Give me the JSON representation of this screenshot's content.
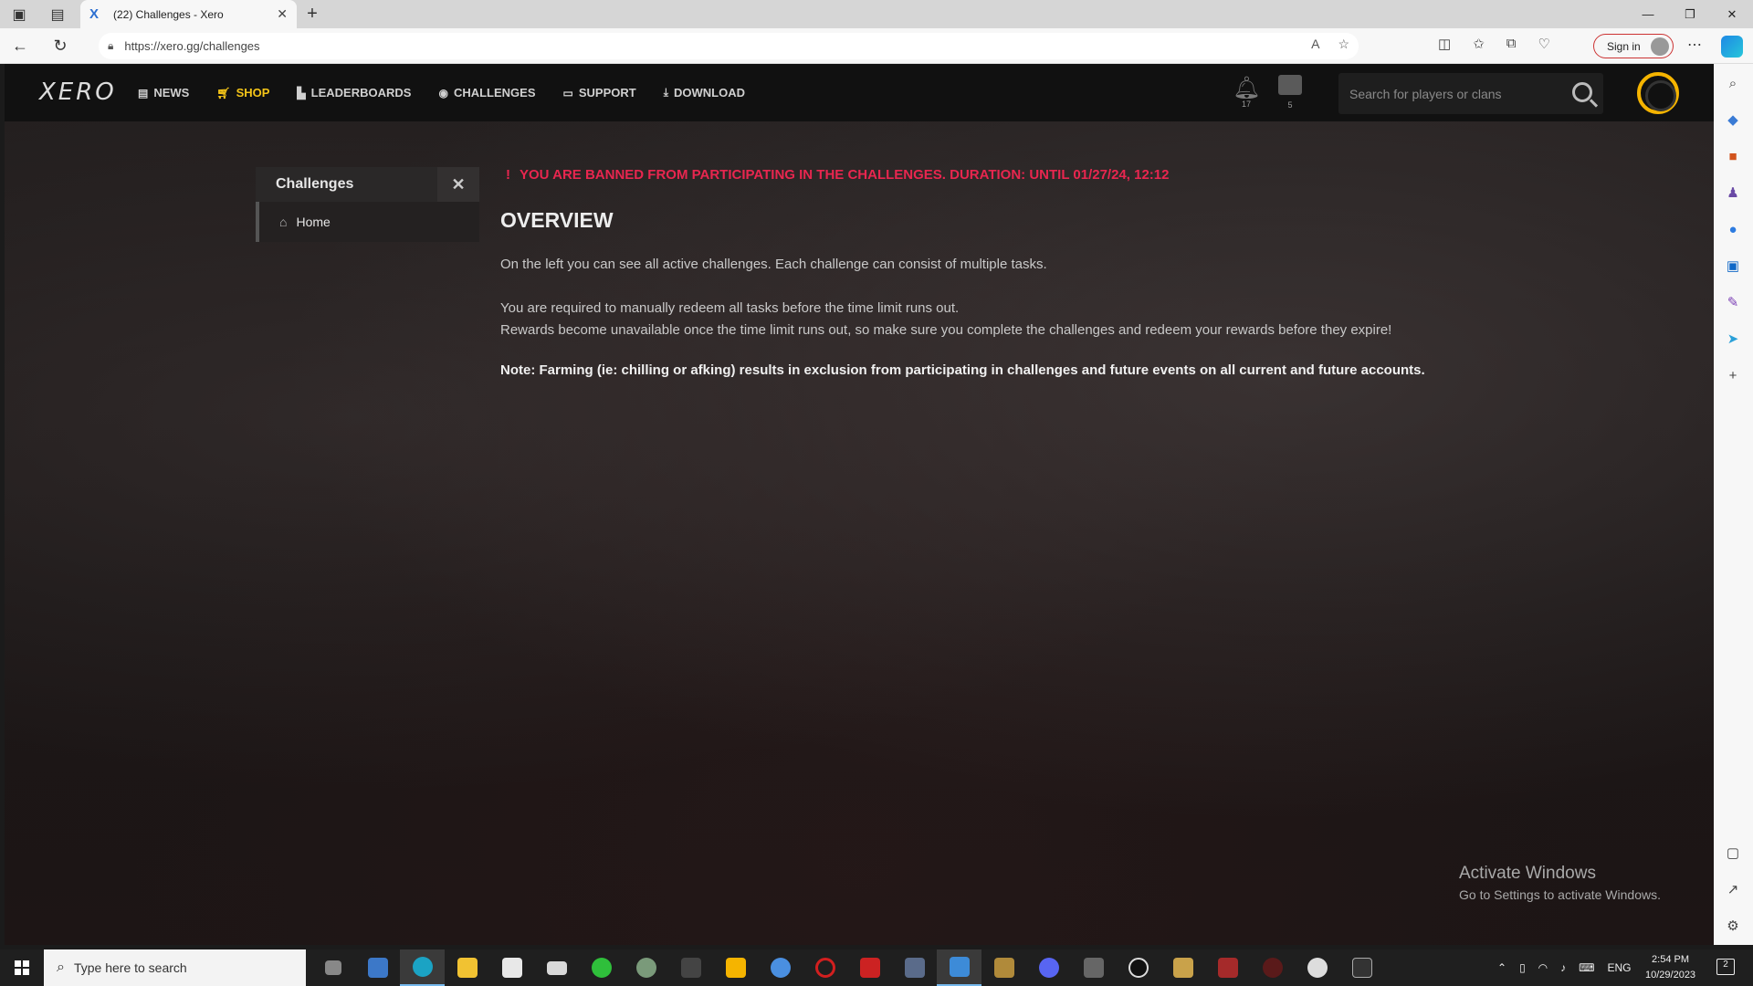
{
  "browser": {
    "tab_title": "(22) Challenges - Xero",
    "tab_favicon": "X",
    "url": "https://xero.gg/challenges",
    "signin_label": "Sign in"
  },
  "site": {
    "logo": "XERO",
    "nav": [
      {
        "label": "NEWS",
        "icon": "newspaper-icon"
      },
      {
        "label": "SHOP",
        "icon": "cart-icon",
        "color": "#f5c518"
      },
      {
        "label": "LEADERBOARDS",
        "icon": "leaderboard-icon"
      },
      {
        "label": "CHALLENGES",
        "icon": "medal-icon"
      },
      {
        "label": "SUPPORT",
        "icon": "ticket-icon"
      },
      {
        "label": "DOWNLOAD",
        "icon": "download-icon"
      }
    ],
    "notifications_count": "17",
    "messages_count": "5",
    "search_placeholder": "Search for players or clans"
  },
  "sidebar": {
    "title": "Challenges",
    "items": [
      {
        "label": "Home",
        "icon": "home-icon"
      }
    ]
  },
  "main": {
    "ban_notice": "YOU ARE BANNED FROM PARTICIPATING IN THE CHALLENGES. DURATION: UNTIL 01/27/24, 12:12",
    "ban_icon": "!",
    "overview_title": "OVERVIEW",
    "para1": "On the left you can see all active challenges. Each challenge can consist of multiple tasks.",
    "para2": "You are required to manually redeem all tasks before the time limit runs out.",
    "para3": "Rewards become unavailable once the time limit runs out, so make sure you complete the challenges and redeem your rewards before they expire!",
    "note": "Note: Farming (ie: chilling or afking) results in exclusion from participating in challenges and future events on all current and future accounts."
  },
  "watermark": {
    "line1": "Activate Windows",
    "line2": "Go to Settings to activate Windows."
  },
  "taskbar": {
    "search_placeholder": "Type here to search",
    "language": "ENG",
    "time": "2:54 PM",
    "date": "10/29/2023",
    "notifications": "2"
  },
  "colors": {
    "accent_yellow": "#f5c518",
    "ban_red": "#e8264f",
    "header_bg": "#111111"
  }
}
